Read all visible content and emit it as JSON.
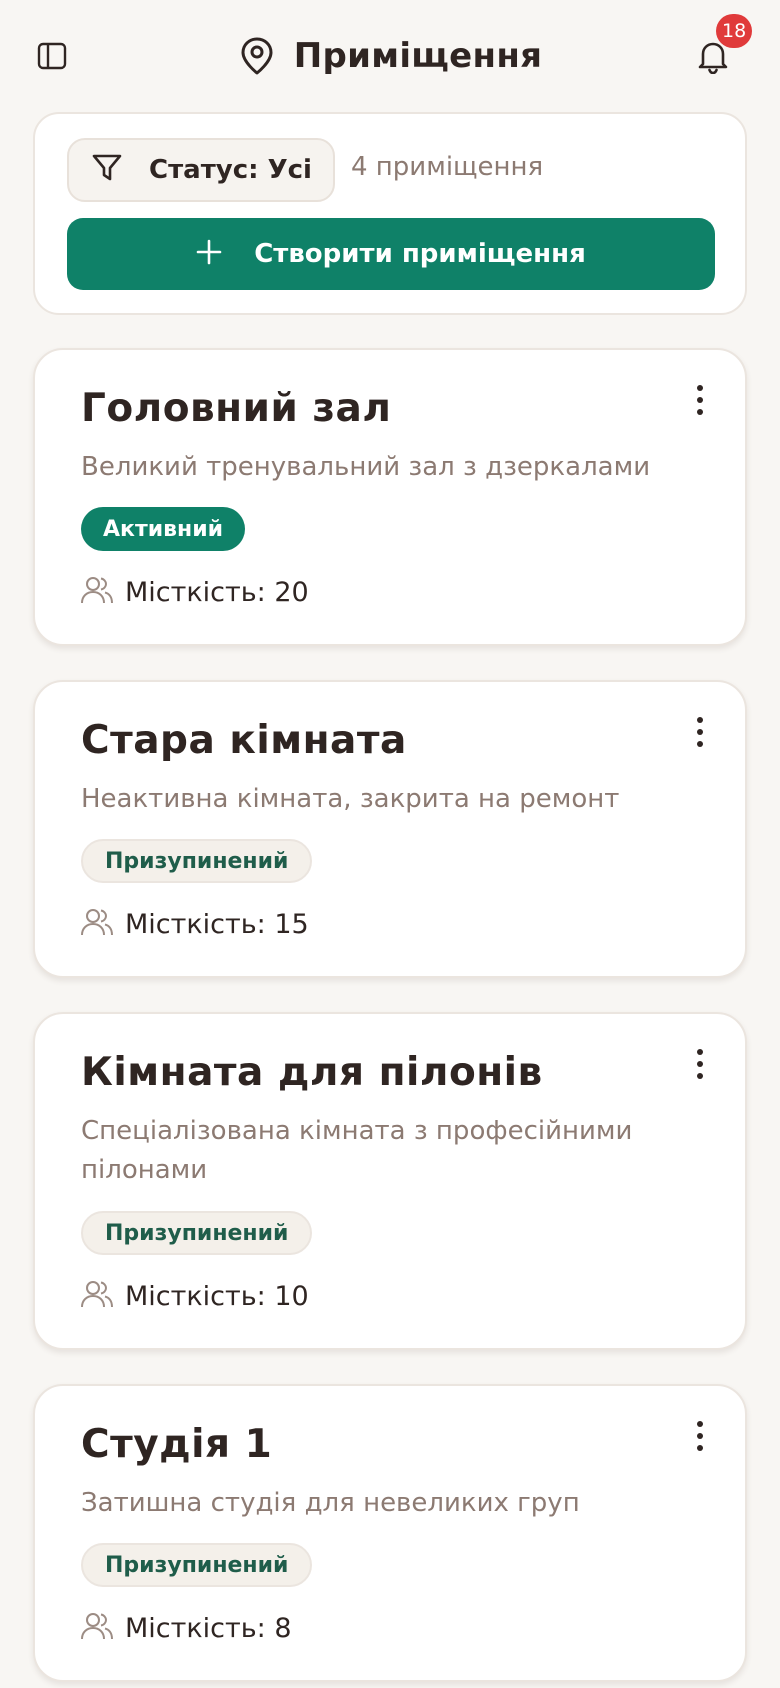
{
  "header": {
    "title": "Приміщення",
    "notification_count": "18"
  },
  "toolbar": {
    "filter_label": "Статус: Усі",
    "count_label": "4 приміщення",
    "create_label": "Створити приміщення"
  },
  "colors": {
    "accent": "#0f8168",
    "badge_red": "#e03a3a",
    "background": "#f8f6f3"
  },
  "rooms": [
    {
      "name": "Головний зал",
      "description": "Великий тренувальний зал з дзеркалами",
      "status": "Активний",
      "capacity": "Місткість: 20"
    },
    {
      "name": "Стара кімната",
      "description": "Неактивна кімната, закрита на ремонт",
      "status": "Призупинений",
      "capacity": "Місткість: 15"
    },
    {
      "name": "Кімната для пілонів",
      "description": "Спеціалізована кімната з професійними пілонами",
      "status": "Призупинений",
      "capacity": "Місткість: 10"
    },
    {
      "name": "Студія 1",
      "description": "Затишна студія для невеликих груп",
      "status": "Призупинений",
      "capacity": "Місткість: 8"
    }
  ]
}
